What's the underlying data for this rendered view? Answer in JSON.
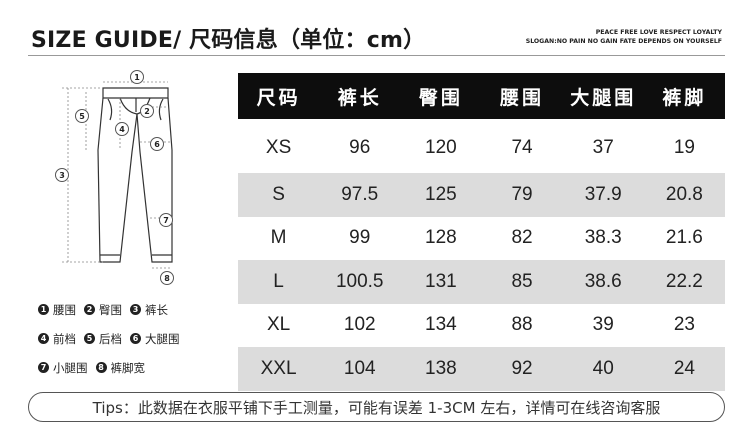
{
  "header": {
    "title": "SIZE GUIDE/ 尺码信息（单位：cm）",
    "slogan_line1": "PEACE FREE LOVE RESPECT LOYALTY",
    "slogan_line2": "SLOGAN:NO PAIN NO GAIN FATE DEPENDS ON YOURSELF"
  },
  "figure": {
    "marks": [
      "1",
      "2",
      "3",
      "4",
      "5",
      "6",
      "7",
      "8"
    ],
    "icon": "pants-outline-icon"
  },
  "legend": [
    {
      "num": "1",
      "label": "腰围"
    },
    {
      "num": "2",
      "label": "臀围"
    },
    {
      "num": "3",
      "label": "裤长"
    },
    {
      "num": "4",
      "label": "前档"
    },
    {
      "num": "5",
      "label": "后档"
    },
    {
      "num": "6",
      "label": "大腿围"
    },
    {
      "num": "7",
      "label": "小腿围"
    },
    {
      "num": "8",
      "label": "裤脚宽"
    }
  ],
  "table": {
    "headers": [
      "尺码",
      "裤长",
      "臀围",
      "腰围",
      "大腿围",
      "裤脚"
    ],
    "rows": [
      [
        "XS",
        "96",
        "120",
        "74",
        "37",
        "19"
      ],
      [
        "S",
        "97.5",
        "125",
        "79",
        "37.9",
        "20.8"
      ],
      [
        "M",
        "99",
        "128",
        "82",
        "38.3",
        "21.6"
      ],
      [
        "L",
        "100.5",
        "131",
        "85",
        "38.6",
        "22.2"
      ],
      [
        "XL",
        "102",
        "134",
        "88",
        "39",
        "23"
      ],
      [
        "XXL",
        "104",
        "138",
        "92",
        "40",
        "24"
      ]
    ]
  },
  "tips": "Tips：此数据在衣服平铺下手工测量，可能有误差 1-3CM 左右，详情可在线咨询客服",
  "colors": {
    "header_bg": "#0d0d0d",
    "shade_row": "#dcdcdc"
  }
}
